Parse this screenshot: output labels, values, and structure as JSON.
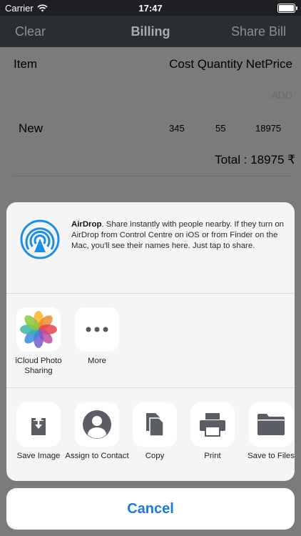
{
  "status_bar": {
    "carrier": "Carrier",
    "time": "17:47"
  },
  "nav": {
    "left_button": "Clear",
    "title": "Billing",
    "right_button": "Share Bill"
  },
  "table": {
    "header_item": "Item",
    "header_columns": "Cost Quantity NetPrice",
    "add_label": "ADD",
    "rows": [
      {
        "item": "New",
        "cost": "345",
        "quantity": "55",
        "net_price": "18975"
      }
    ],
    "total": "Total : 18975 ₹"
  },
  "share_sheet": {
    "airdrop": {
      "title": "AirDrop",
      "description": ". Share instantly with people nearby. If they turn on AirDrop from Control Centre on iOS or from Finder on the Mac, you'll see their names here. Just tap to share."
    },
    "apps": [
      {
        "label": "iCloud Photo Sharing",
        "icon": "photos-icon"
      },
      {
        "label": "More",
        "icon": "more-icon"
      }
    ],
    "actions": [
      {
        "label": "Save Image",
        "icon": "save-image-icon"
      },
      {
        "label": "Assign to Contact",
        "icon": "contact-icon"
      },
      {
        "label": "Copy",
        "icon": "copy-icon"
      },
      {
        "label": "Print",
        "icon": "print-icon"
      },
      {
        "label": "Save to Files",
        "icon": "folder-icon"
      }
    ],
    "cancel": "Cancel"
  },
  "colors": {
    "accent": "#1a7ae2",
    "nav_bg": "#2a2d31",
    "dim_bg": "#7b7b7b"
  }
}
